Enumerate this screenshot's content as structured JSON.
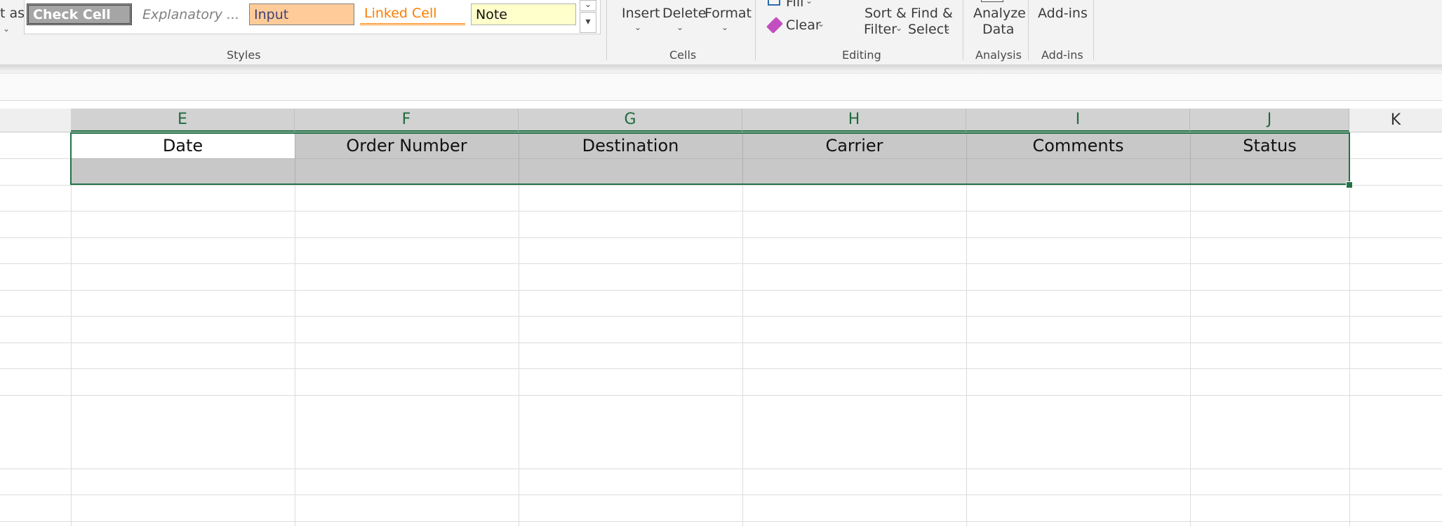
{
  "ribbon": {
    "format_as_fragment": "t as",
    "styles": {
      "check_cell": "Check Cell",
      "explanatory": "Explanatory ...",
      "input": "Input",
      "linked_cell": "Linked Cell",
      "note": "Note",
      "group_label": "Styles"
    },
    "cells": {
      "insert": "Insert",
      "delete": "Delete",
      "format": "Format",
      "group_label": "Cells"
    },
    "editing": {
      "fill": "Fill",
      "clear": "Clear",
      "sort_filter_line1": "Sort &",
      "sort_filter_line2": "Filter",
      "find_select_line1": "Find &",
      "find_select_line2": "Select",
      "group_label": "Editing"
    },
    "analysis": {
      "analyze_line1": "Analyze",
      "analyze_line2": "Data",
      "group_label": "Analysis"
    },
    "addins": {
      "label": "Add-ins",
      "group_label": "Add-ins"
    }
  },
  "columns": [
    "E",
    "F",
    "G",
    "H",
    "I",
    "J",
    "K"
  ],
  "header_row": [
    "Date",
    "Order Number",
    "Destination",
    "Carrier",
    "Comments",
    "Status"
  ],
  "colors": {
    "excel_green": "#217346",
    "check_cell_bg": "#a5a5a5",
    "input_bg": "#ffcc99",
    "linked_cell_text": "#fa7d00",
    "note_bg": "#ffffcc",
    "selection_fill": "#c8c8c8"
  }
}
